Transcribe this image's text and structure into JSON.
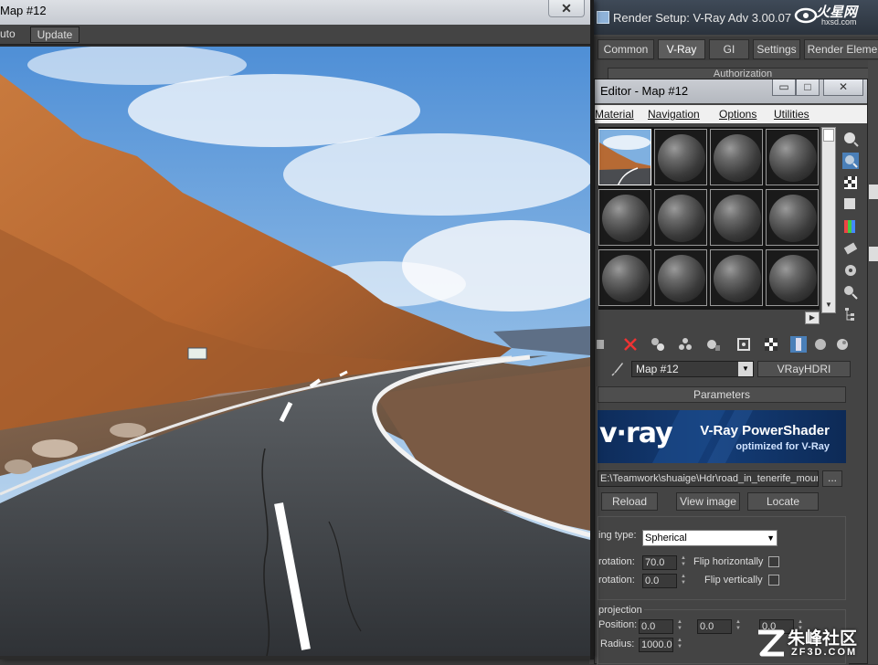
{
  "preview_window": {
    "title": "Map #12",
    "close_label": "✕",
    "toolbar": {
      "auto_label": "uto",
      "update_label": "Update"
    }
  },
  "render_setup": {
    "title": "Render Setup: V-Ray Adv 3.00.07",
    "tabs": [
      "Common",
      "V-Ray",
      "GI",
      "Settings",
      "Render Eleme"
    ],
    "active_tab": "V-Ray",
    "hidden_rollout": "Authorization"
  },
  "logo": {
    "text": "火星网",
    "sub": "hxsd.com"
  },
  "material_editor": {
    "title": "Editor - Map #12",
    "window_buttons": {
      "minimize": "▭",
      "maximize": "□",
      "close": "✕"
    },
    "menus": [
      "Material",
      "Navigation",
      "Options",
      "Utilities"
    ],
    "map_name": "Map #12",
    "map_type": "VRayHDRI",
    "parameters": {
      "header": "Parameters",
      "banner_logo": "v·ray",
      "banner_title": "V-Ray PowerShader",
      "banner_subtitle": "optimized for V-Ray",
      "file_path": "E:\\Teamwork\\shuaige\\Hdr\\road_in_tenerife_moun",
      "browse_label": "...",
      "reload_label": "Reload",
      "view_image_label": "View image",
      "locate_label": "Locate",
      "mapping_type_label": "ing type:",
      "mapping_type_value": "Spherical",
      "h_rotation_label": "rotation:",
      "h_rotation_value": "70.0",
      "v_rotation_label": "rotation:",
      "v_rotation_value": "0.0",
      "flip_h_label": "Flip horizontally",
      "flip_v_label": "Flip vertically",
      "projection_label": "projection",
      "position_label": "Position:",
      "position_values": [
        "0.0",
        "0.0",
        "0.0"
      ],
      "radius_label": "Radius:",
      "radius_value": "1000.0"
    }
  },
  "watermark": {
    "main": "朱峰社区",
    "sub": "ZF3D.COM"
  }
}
